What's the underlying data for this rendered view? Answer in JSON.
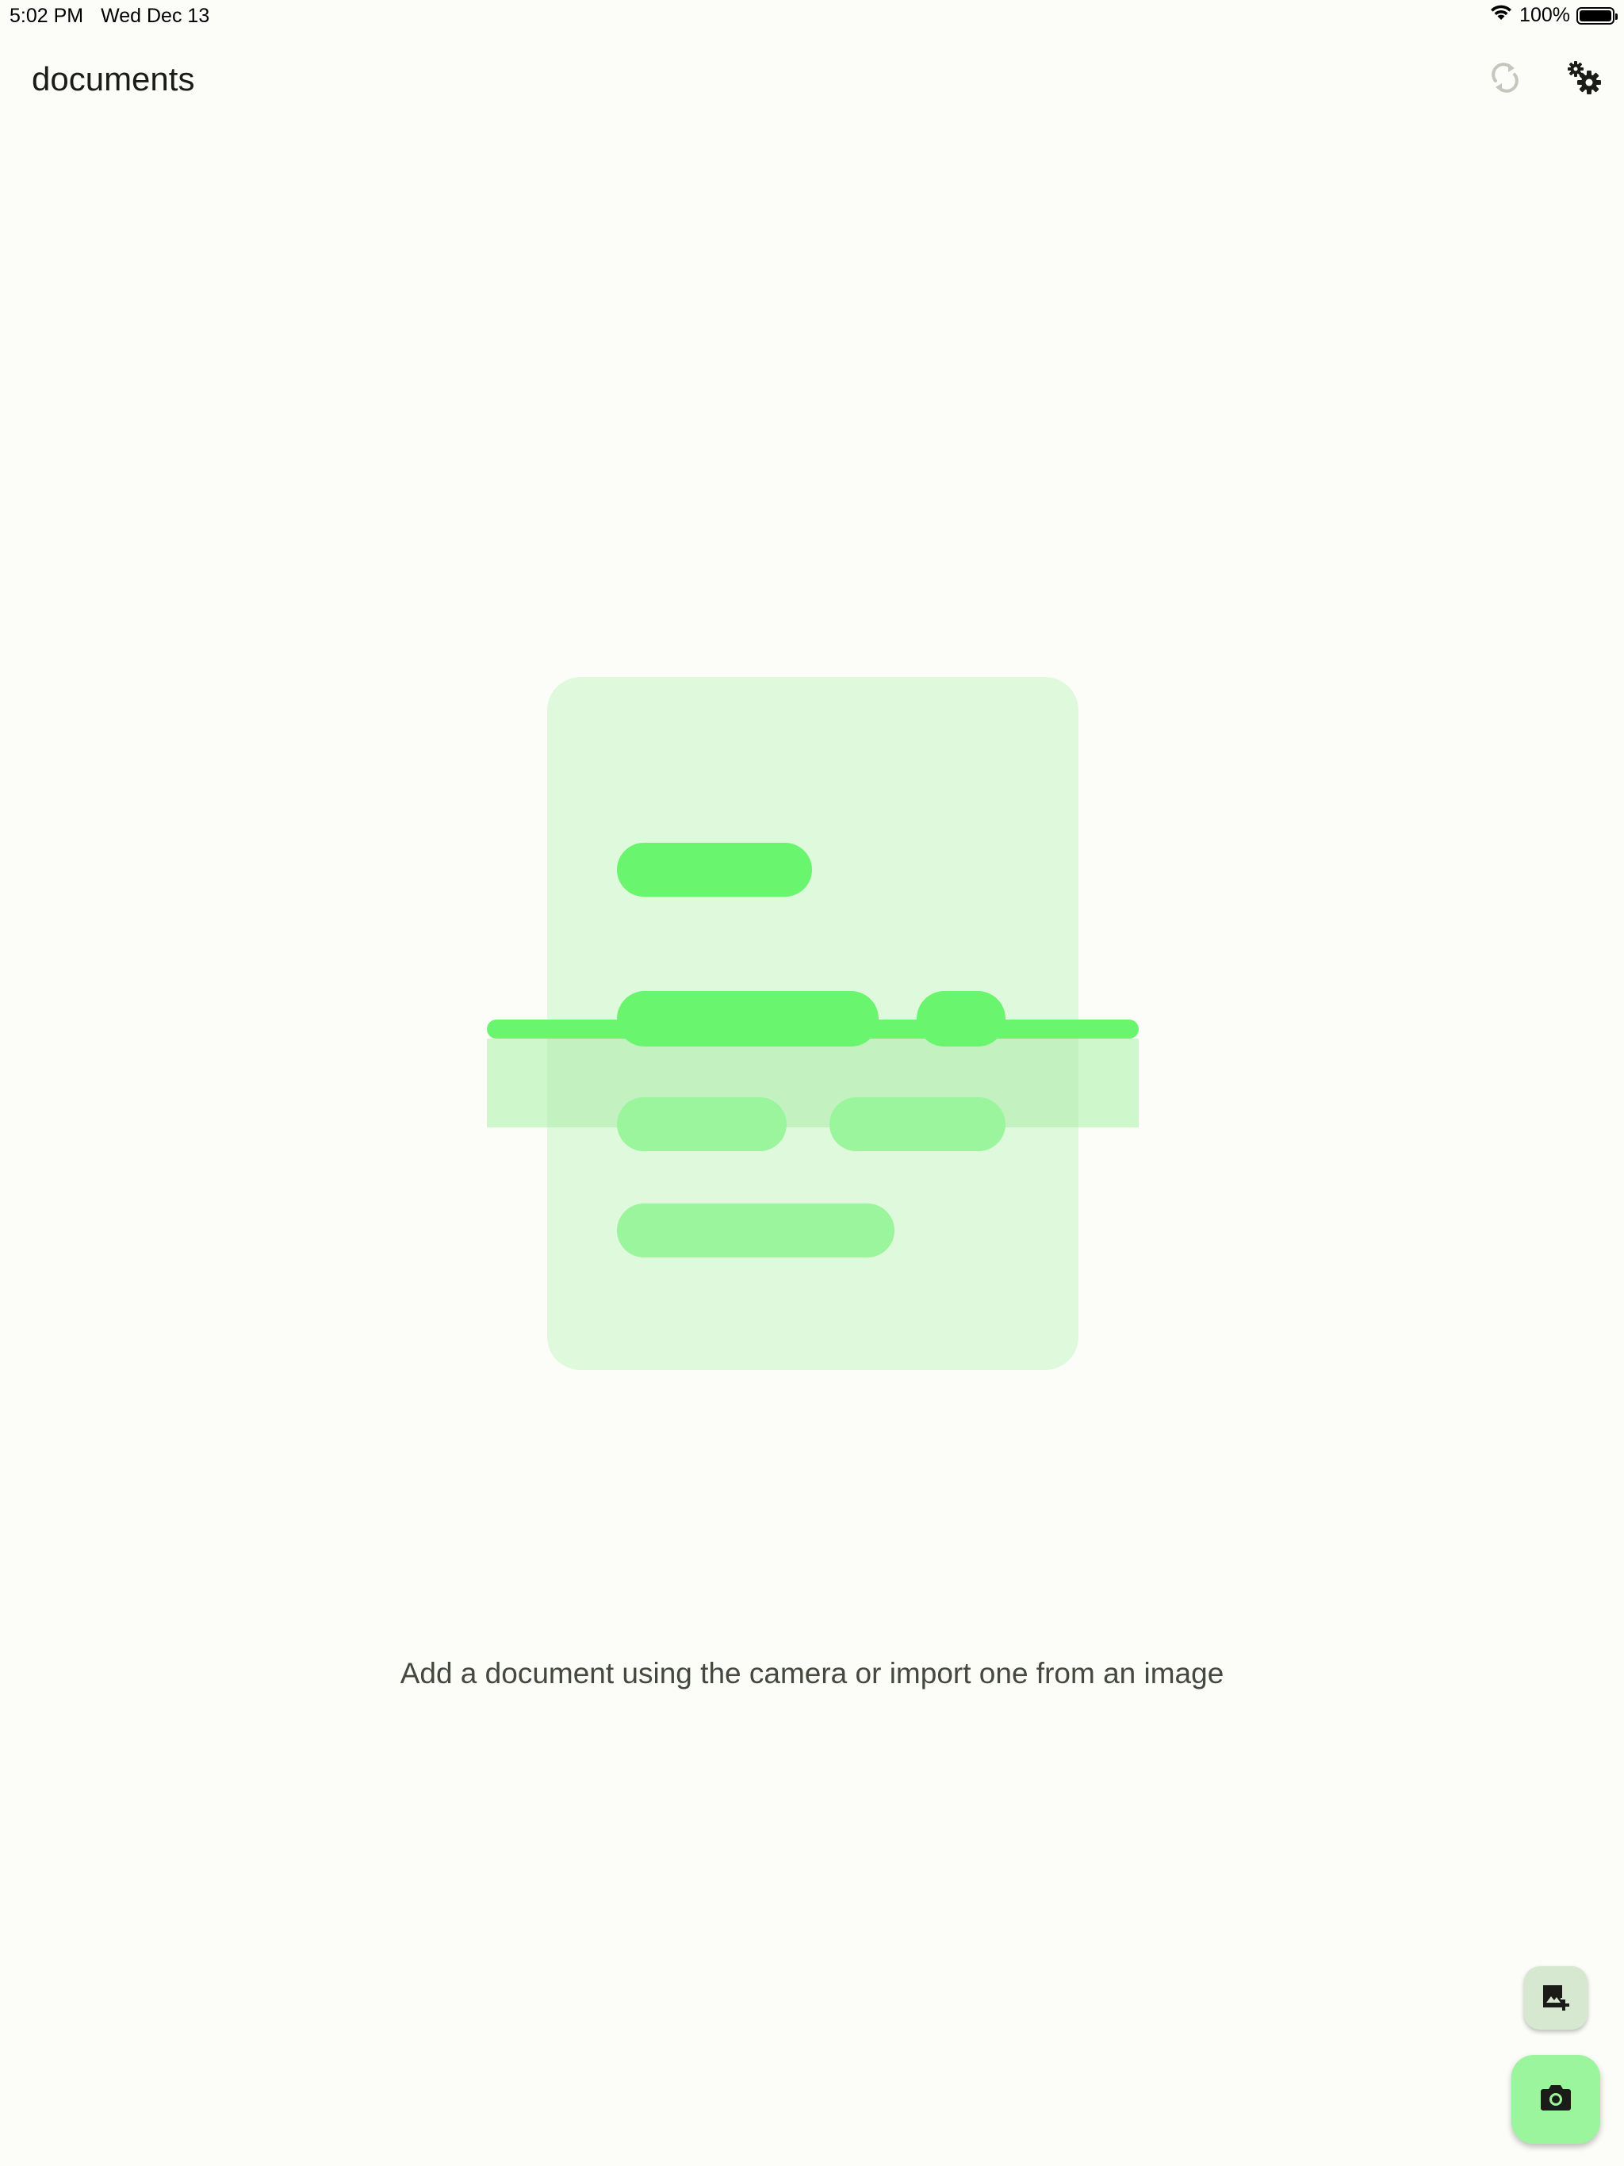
{
  "status_bar": {
    "time": "5:02 PM",
    "date": "Wed Dec 13",
    "battery": "100%"
  },
  "app_bar": {
    "title": "documents",
    "sync_icon": "sync-icon",
    "settings_icon": "settings-gears-icon"
  },
  "empty_state": {
    "message": "Add a document using the camera or import one from an image",
    "illustration_icon": "document-scan-illustration"
  },
  "fabs": {
    "import_icon": "add-photo-icon",
    "camera_icon": "camera-icon"
  },
  "colors": {
    "background": "#fcfdf8",
    "accent_green": "#69f56d",
    "light_green": "#dff9dc",
    "fab_camera": "#9af59c",
    "fab_import": "#d7e8d0"
  }
}
